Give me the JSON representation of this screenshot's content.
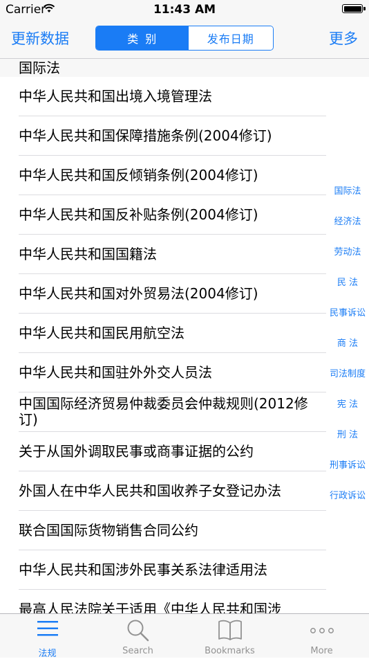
{
  "status": {
    "carrier": "Carrier",
    "time": "11:43 AM",
    "battery_level": 1.0
  },
  "nav": {
    "left_button": "更新数据",
    "right_button": "更多",
    "segments": [
      {
        "label": "类别",
        "selected": true
      },
      {
        "label": "发布日期",
        "selected": false
      }
    ]
  },
  "section": {
    "title": "国际法"
  },
  "rows": [
    "中华人民共和国出境入境管理法",
    "中华人民共和国保障措施条例(2004修订)",
    "中华人民共和国反倾销条例(2004修订)",
    "中华人民共和国反补贴条例(2004修订)",
    "中华人民共和国国籍法",
    "中华人民共和国对外贸易法(2004修订)",
    "中华人民共和国民用航空法",
    "中华人民共和国驻外外交人员法",
    "中国国际经济贸易仲裁委员会仲裁规则(2012修订)",
    "关于从国外调取民事或商事证据的公约",
    "外国人在中华人民共和国收养子女登记办法",
    "联合国国际货物销售合同公约",
    "中华人民共和国涉外民事关系法律适用法",
    "最高人民法院关于适用《中华人民共和国涉"
  ],
  "index": [
    "国际法",
    "经济法",
    "劳动法",
    "民 法",
    "民事诉讼",
    "商 法",
    "司法制度",
    "宪 法",
    "刑 法",
    "刑事诉讼",
    "行政诉讼"
  ],
  "tabs": [
    {
      "label": "法规",
      "icon": "list-icon",
      "active": true
    },
    {
      "label": "Search",
      "icon": "search-icon",
      "active": false
    },
    {
      "label": "Bookmarks",
      "icon": "book-icon",
      "active": false
    },
    {
      "label": "More",
      "icon": "more-dots-icon",
      "active": false
    }
  ],
  "colors": {
    "accent": "#1a7cf5",
    "inactive_tab": "#929292",
    "bar_bg": "#f7f7f7"
  }
}
